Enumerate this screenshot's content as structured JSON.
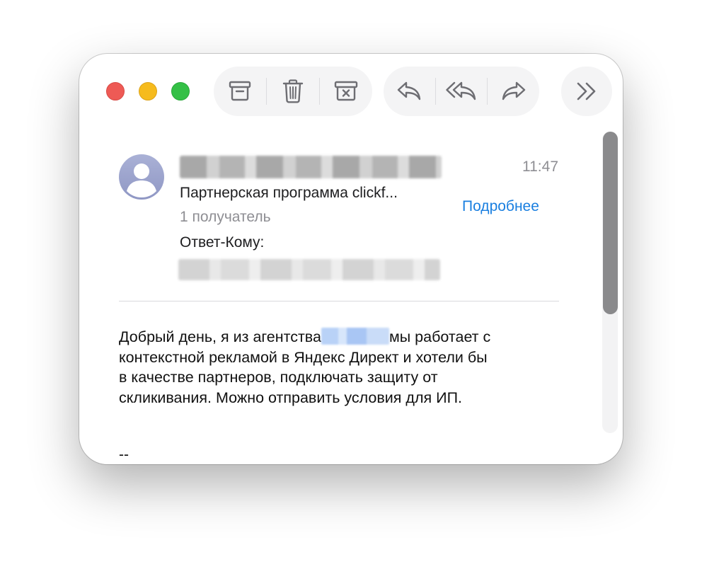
{
  "window": {
    "controls": {
      "close": "close",
      "minimize": "minimize",
      "zoom": "zoom"
    }
  },
  "toolbar": {
    "groups": [
      {
        "items": [
          {
            "icon": "archive-icon",
            "label": "Archive"
          },
          {
            "icon": "trash-icon",
            "label": "Delete"
          },
          {
            "icon": "junk-icon",
            "label": "Junk"
          }
        ]
      },
      {
        "items": [
          {
            "icon": "reply-icon",
            "label": "Reply"
          },
          {
            "icon": "reply-all-icon",
            "label": "Reply All"
          },
          {
            "icon": "forward-icon",
            "label": "Forward"
          }
        ]
      },
      {
        "items": [
          {
            "icon": "chevron-double-right-icon",
            "label": "More"
          }
        ]
      }
    ]
  },
  "message": {
    "time": "11:47",
    "subject": "Партнерская программа clickf...",
    "recipients": "1 получатель",
    "details_link": "Подробнее",
    "reply_to_label": "Ответ-Кому:",
    "body_lines": [
      "Добрый день, я из агентства",
      "мы работает с",
      "контекстной рекламой в Яндекс Директ и хотели бы",
      "в качестве партнеров, подключать защиту от",
      "скликивания. Можно отправить условия для ИП."
    ],
    "signature": "--"
  },
  "colors": {
    "accent": "#1a7fe0",
    "close": "#ee5a55",
    "minimize": "#f6bb1d",
    "zoom": "#34c046",
    "secondary_text": "#8e8e93"
  }
}
